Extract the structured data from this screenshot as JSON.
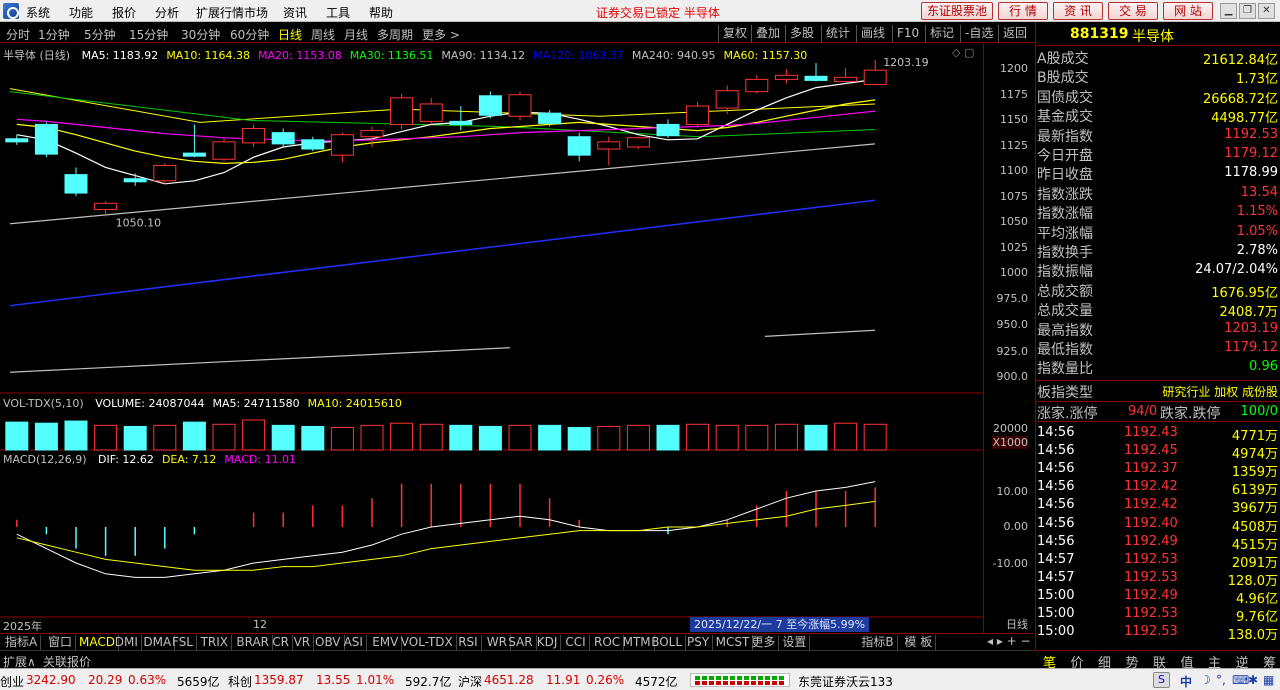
{
  "menu": [
    "系统",
    "功能",
    "报价",
    "分析",
    "扩展行情市场",
    "资讯",
    "工具",
    "帮助"
  ],
  "lock_text": "证券交易已锁定 半导体",
  "top_buttons": [
    "东证股票池",
    "行 情",
    "资 讯",
    "交 易",
    "网 站"
  ],
  "window_buttons": [
    "▁",
    "❐",
    "✕"
  ],
  "periods": [
    "分时",
    "1分钟",
    "5分钟",
    "15分钟",
    "30分钟",
    "60分钟",
    "日线",
    "周线",
    "月线",
    "多周期",
    "更多 >"
  ],
  "active_period": "日线",
  "tools": [
    "复权",
    "叠加",
    "多股",
    "统计",
    "画线",
    "F10",
    "标记",
    "-自选",
    "返回"
  ],
  "main_legend": {
    "name": "半导体 (日线)",
    "items": [
      {
        "label": "MA5: 1183.92",
        "color": "#ffffff"
      },
      {
        "label": "MA10: 1164.38",
        "color": "#ffff00"
      },
      {
        "label": "MA20: 1153.08",
        "color": "#ff00ff"
      },
      {
        "label": "MA30: 1136.51",
        "color": "#00ff00"
      },
      {
        "label": "MA90: 1134.12",
        "color": "#c0c0c0"
      },
      {
        "label": "MA120: 1063.37",
        "color": "#0000ff"
      },
      {
        "label": "MA240: 940.95",
        "color": "#c0c0c0"
      },
      {
        "label": "MA60: 1157.30",
        "color": "#ffff00"
      }
    ]
  },
  "price_axis": [
    "1200",
    "1175",
    "1150",
    "1125",
    "1100",
    "1075",
    "1050",
    "1025",
    "1000",
    "975.0",
    "950.0",
    "925.0",
    "900.0"
  ],
  "high_label": "1203.19",
  "low_label": "1050.10",
  "vol_legend": {
    "name": "VOL-TDX(5,10)",
    "items": [
      {
        "label": "VOLUME: 24087044",
        "color": "#ffffff"
      },
      {
        "label": "MA5: 24711580",
        "color": "#ffffff"
      },
      {
        "label": "MA10: 24015610",
        "color": "#ffff00"
      }
    ]
  },
  "vol_axis": {
    "top": "20000",
    "unit": "X1000"
  },
  "macd_legend": {
    "name": "MACD(12,26,9)",
    "items": [
      {
        "label": "DIF: 12.62",
        "color": "#ffffff"
      },
      {
        "label": "DEA: 7.12",
        "color": "#ffff00"
      },
      {
        "label": "MACD: 11.01",
        "color": "#ff00ff"
      }
    ]
  },
  "macd_axis": [
    "10.00",
    "0.00",
    "-10.00"
  ],
  "x_labels": {
    "year": "2025年",
    "month": "12"
  },
  "date_tip": "2025/12/22/一 7 至今涨幅5.99%",
  "indicator_tabs": [
    "指标A",
    "窗口",
    "MACD",
    "DMI",
    "DMA",
    "FSL",
    "TRIX",
    "BRAR",
    "CR",
    "VR",
    "OBV",
    "ASI",
    "EMV",
    "VOL-TDX",
    "RSI",
    "WR",
    "SAR",
    "KDJ",
    "CCI",
    "ROC",
    "MTM",
    "BOLL",
    "PSY",
    "MCST",
    "更多",
    "设置",
    "指标B",
    "模 板"
  ],
  "active_tab": "MACD",
  "sub_tabs": [
    "扩展∧",
    "关联报价"
  ],
  "daily_label": "日线",
  "right_panel": {
    "code": "881319",
    "name": "半导体",
    "stats": [
      {
        "label": "A股成交",
        "value": "21612.84亿",
        "color": "#ffff00"
      },
      {
        "label": "B股成交",
        "value": "1.73亿",
        "color": "#ffff00"
      },
      {
        "label": "国债成交",
        "value": "26668.72亿",
        "color": "#ffff00"
      },
      {
        "label": "基金成交",
        "value": "4498.77亿",
        "color": "#ffff00"
      },
      {
        "label": "最新指数",
        "value": "1192.53",
        "color": "#ff3333"
      },
      {
        "label": "今日开盘",
        "value": "1179.12",
        "color": "#ff3333"
      },
      {
        "label": "昨日收盘",
        "value": "1178.99",
        "color": "#ffffff"
      },
      {
        "label": "指数涨跌",
        "value": "13.54",
        "color": "#ff3333"
      },
      {
        "label": "指数涨幅",
        "value": "1.15%",
        "color": "#ff3333"
      },
      {
        "label": "平均涨幅",
        "value": "1.05%",
        "color": "#ff3333"
      },
      {
        "label": "指数换手",
        "value": "2.78%",
        "color": "#ffffff"
      },
      {
        "label": "指数振幅",
        "value": "24.07/2.04%",
        "color": "#ffffff"
      },
      {
        "label": "总成交额",
        "value": "1676.95亿",
        "color": "#ffff00"
      },
      {
        "label": "总成交量",
        "value": "2408.7万",
        "color": "#ffff00"
      },
      {
        "label": "最高指数",
        "value": "1203.19",
        "color": "#ff3333"
      },
      {
        "label": "最低指数",
        "value": "1179.12",
        "color": "#ff3333"
      },
      {
        "label": "指数量比",
        "value": "0.96",
        "color": "#00ff00"
      }
    ],
    "type_label": "板指类型",
    "type_value": "研究行业 加权 成份股",
    "adv_label": "涨家.涨停",
    "adv_value": "94/0",
    "dec_label": "跌家.跌停",
    "dec_value": "100/0",
    "ticks": [
      {
        "time": "14:56",
        "price": "1192.43",
        "vol": "4771万"
      },
      {
        "time": "14:56",
        "price": "1192.45",
        "vol": "4974万"
      },
      {
        "time": "14:56",
        "price": "1192.37",
        "vol": "1359万"
      },
      {
        "time": "14:56",
        "price": "1192.42",
        "vol": "6139万"
      },
      {
        "time": "14:56",
        "price": "1192.42",
        "vol": "3967万"
      },
      {
        "time": "14:56",
        "price": "1192.40",
        "vol": "4508万"
      },
      {
        "time": "14:56",
        "price": "1192.49",
        "vol": "4515万"
      },
      {
        "time": "14:57",
        "price": "1192.53",
        "vol": "2091万"
      },
      {
        "time": "14:57",
        "price": "1192.53",
        "vol": "128.0万"
      },
      {
        "time": "15:00",
        "price": "1192.49",
        "vol": "4.96亿"
      },
      {
        "time": "15:00",
        "price": "1192.53",
        "vol": "9.76亿"
      },
      {
        "time": "15:00",
        "price": "1192.53",
        "vol": "138.0万"
      }
    ],
    "tabs": [
      "笔",
      "价",
      "细",
      "势",
      "联",
      "值",
      "主",
      "逆",
      "筹"
    ]
  },
  "status": {
    "items": [
      {
        "name": "创业",
        "value": "3242.90",
        "chg": "20.29",
        "pct": "0.63%",
        "amt": "5659亿"
      },
      {
        "name": "科创",
        "value": "1359.87",
        "chg": "13.55",
        "pct": "1.01%",
        "amt": "592.7亿"
      },
      {
        "name": "沪深",
        "value": "4651.28",
        "chg": "11.91",
        "pct": "0.26%",
        "amt": "4572亿"
      }
    ],
    "broker": "东莞证券沃云133",
    "ime": [
      "中",
      "☽",
      "°,",
      "⌨",
      "✱",
      "▦"
    ]
  },
  "colors": {
    "up": "#ff3333",
    "down": "#54ffff",
    "grid": "#8b0000"
  },
  "chart_data": [
    {
      "type": "candlestick",
      "title": "半导体 (日线)",
      "ylim": [
        890,
        1210
      ],
      "ohlc": [
        [
          1126,
          1130,
          1120,
          1123
        ],
        [
          1140,
          1142,
          1108,
          1111
        ],
        [
          1091,
          1098,
          1070,
          1073
        ],
        [
          1057,
          1065,
          1050,
          1063
        ],
        [
          1087,
          1092,
          1080,
          1084
        ],
        [
          1085,
          1102,
          1082,
          1100
        ],
        [
          1112,
          1140,
          1108,
          1109
        ],
        [
          1106,
          1126,
          1104,
          1123
        ],
        [
          1122,
          1140,
          1118,
          1136
        ],
        [
          1132,
          1136,
          1118,
          1121
        ],
        [
          1125,
          1128,
          1114,
          1116
        ],
        [
          1110,
          1132,
          1103,
          1130
        ],
        [
          1128,
          1138,
          1118,
          1134
        ],
        [
          1140,
          1170,
          1135,
          1166
        ],
        [
          1143,
          1166,
          1140,
          1160
        ],
        [
          1143,
          1158,
          1134,
          1140
        ],
        [
          1168,
          1172,
          1146,
          1149
        ],
        [
          1148,
          1172,
          1144,
          1169
        ],
        [
          1151,
          1154,
          1138,
          1141
        ],
        [
          1128,
          1132,
          1104,
          1110
        ],
        [
          1116,
          1128,
          1100,
          1123
        ],
        [
          1118,
          1128,
          1116,
          1127
        ],
        [
          1140,
          1145,
          1127,
          1129
        ],
        [
          1140,
          1162,
          1137,
          1158
        ],
        [
          1156,
          1178,
          1150,
          1173
        ],
        [
          1172,
          1188,
          1170,
          1184
        ],
        [
          1184,
          1194,
          1180,
          1188
        ],
        [
          1187,
          1200,
          1182,
          1183
        ],
        [
          1182,
          1195,
          1180,
          1186
        ],
        [
          1179,
          1203,
          1179,
          1193
        ]
      ],
      "ma": [
        {
          "name": "MA5",
          "color": "#ffffff",
          "values": [
            1130,
            1125,
            1112,
            1098,
            1090,
            1082,
            1085,
            1093,
            1108,
            1118,
            1122,
            1124,
            1126,
            1133,
            1140,
            1142,
            1148,
            1152,
            1151,
            1145,
            1138,
            1130,
            1125,
            1126,
            1140,
            1154,
            1166,
            1176,
            1180,
            1184
          ]
        },
        {
          "name": "MA10",
          "color": "#ffff00",
          "values": [
            1140,
            1137,
            1130,
            1122,
            1114,
            1108,
            1104,
            1102,
            1103,
            1106,
            1112,
            1118,
            1122,
            1125,
            1128,
            1132,
            1136,
            1138,
            1140,
            1142,
            1140,
            1138,
            1136,
            1134,
            1137,
            1142,
            1148,
            1154,
            1160,
            1164
          ]
        },
        {
          "name": "MA20",
          "color": "#ff00ff",
          "values": [
            1145,
            1143,
            1140,
            1137,
            1134,
            1131,
            1129,
            1127,
            1126,
            1125,
            1124,
            1124,
            1125,
            1126,
            1127,
            1128,
            1130,
            1132,
            1133,
            1134,
            1135,
            1136,
            1137,
            1138,
            1139,
            1141,
            1144,
            1147,
            1150,
            1153
          ]
        }
      ],
      "volume": [
        26,
        25,
        27,
        23,
        22,
        23,
        26,
        24,
        28,
        23,
        22,
        21,
        23,
        25,
        24,
        23,
        22,
        23,
        23,
        21,
        22,
        23,
        23,
        24,
        23,
        23,
        24,
        23,
        25,
        24
      ],
      "macd": {
        "dif": [
          -2,
          -6,
          -10,
          -13,
          -14,
          -14,
          -13,
          -12,
          -10,
          -9,
          -8,
          -7,
          -5,
          -2,
          0,
          1,
          2,
          3,
          2,
          0,
          -1,
          -1,
          -1,
          0,
          2,
          5,
          8,
          10,
          11,
          12.62
        ],
        "dea": [
          -3,
          -5,
          -7,
          -9,
          -10,
          -11,
          -12,
          -12,
          -12,
          -11,
          -11,
          -10,
          -9,
          -8,
          -6,
          -5,
          -4,
          -3,
          -2,
          -1,
          -1,
          -1,
          0,
          0,
          1,
          2,
          3,
          5,
          6,
          7.12
        ]
      }
    }
  ]
}
